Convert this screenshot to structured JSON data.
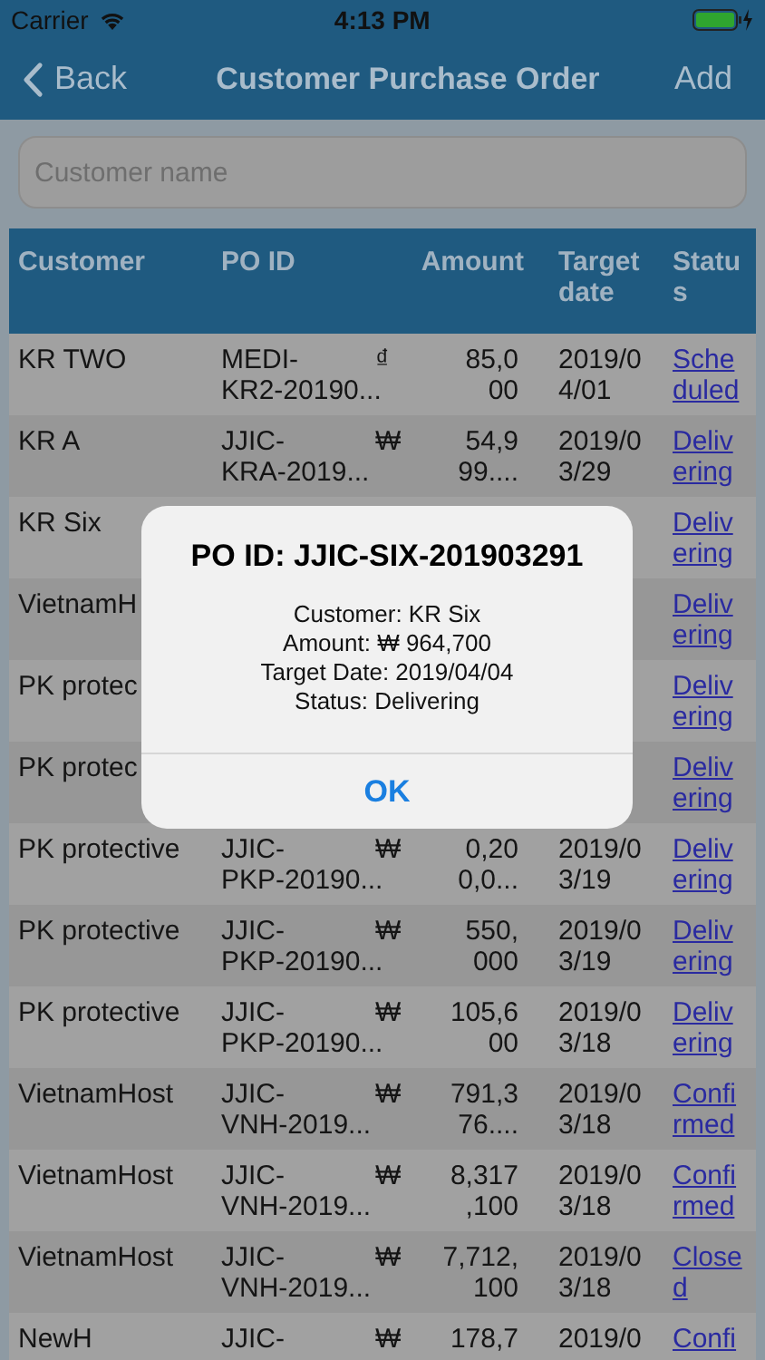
{
  "status_bar": {
    "carrier": "Carrier",
    "time": "4:13 PM"
  },
  "nav": {
    "back": "Back",
    "title": "Customer Purchase Order",
    "action": "Add"
  },
  "search": {
    "placeholder": "Customer name"
  },
  "table": {
    "columns": [
      "Customer",
      "PO ID",
      "",
      "Amount",
      "Target\ndate",
      "Statu\ns"
    ],
    "rows": [
      {
        "customer": "KR TWO",
        "po_id": "MEDI-\nKR2-20190...",
        "currency": "₫",
        "amount": "85,0\n00",
        "target_date": "2019/0\n4/01",
        "status": "Sche\nduled"
      },
      {
        "customer": "KR A",
        "po_id": "JJIC-\nKRA-2019...",
        "currency": "₩",
        "amount": "54,9\n99....",
        "target_date": "2019/0\n3/29",
        "status": "Deliv\nering"
      },
      {
        "customer": "KR Six",
        "status": "Deliv\nering"
      },
      {
        "customer": "VietnamH",
        "status": "Deliv\nering"
      },
      {
        "customer": "PK protec",
        "status": "Deliv\nering"
      },
      {
        "customer": "PK protec",
        "status": "Deliv\nering"
      },
      {
        "customer": "PK protective",
        "po_id": "JJIC-\nPKP-20190...",
        "currency": "₩",
        "amount": "0,20\n0,0...",
        "target_date": "2019/0\n3/19",
        "status": "Deliv\nering"
      },
      {
        "customer": "PK protective",
        "po_id": "JJIC-\nPKP-20190...",
        "currency": "₩",
        "amount": "550,\n000",
        "target_date": "2019/0\n3/19",
        "status": "Deliv\nering"
      },
      {
        "customer": "PK protective",
        "po_id": "JJIC-\nPKP-20190...",
        "currency": "₩",
        "amount": "105,6\n00",
        "target_date": "2019/0\n3/18",
        "status": "Deliv\nering"
      },
      {
        "customer": "VietnamHost",
        "po_id": "JJIC-\nVNH-2019...",
        "currency": "₩",
        "amount": "791,3\n76....",
        "target_date": "2019/0\n3/18",
        "status": "Confi\nrmed"
      },
      {
        "customer": "VietnamHost",
        "po_id": "JJIC-\nVNH-2019...",
        "currency": "₩",
        "amount": "8,317\n,100",
        "target_date": "2019/0\n3/18",
        "status": "Confi\nrmed"
      },
      {
        "customer": "VietnamHost",
        "po_id": "JJIC-\nVNH-2019...",
        "currency": "₩",
        "amount": "7,712,\n100",
        "target_date": "2019/0\n3/18",
        "status": "Close\nd"
      },
      {
        "customer": "NewH",
        "po_id": "JJIC-",
        "currency": "₩",
        "amount": "178,7",
        "target_date": "2019/0",
        "status": "Confi"
      }
    ]
  },
  "alert": {
    "title": "PO ID: JJIC-SIX-201903291",
    "lines": [
      "Customer: KR Six",
      "Amount: ₩ 964,700",
      "Target Date: 2019/04/04",
      "Status: Delivering"
    ],
    "button": "OK"
  }
}
